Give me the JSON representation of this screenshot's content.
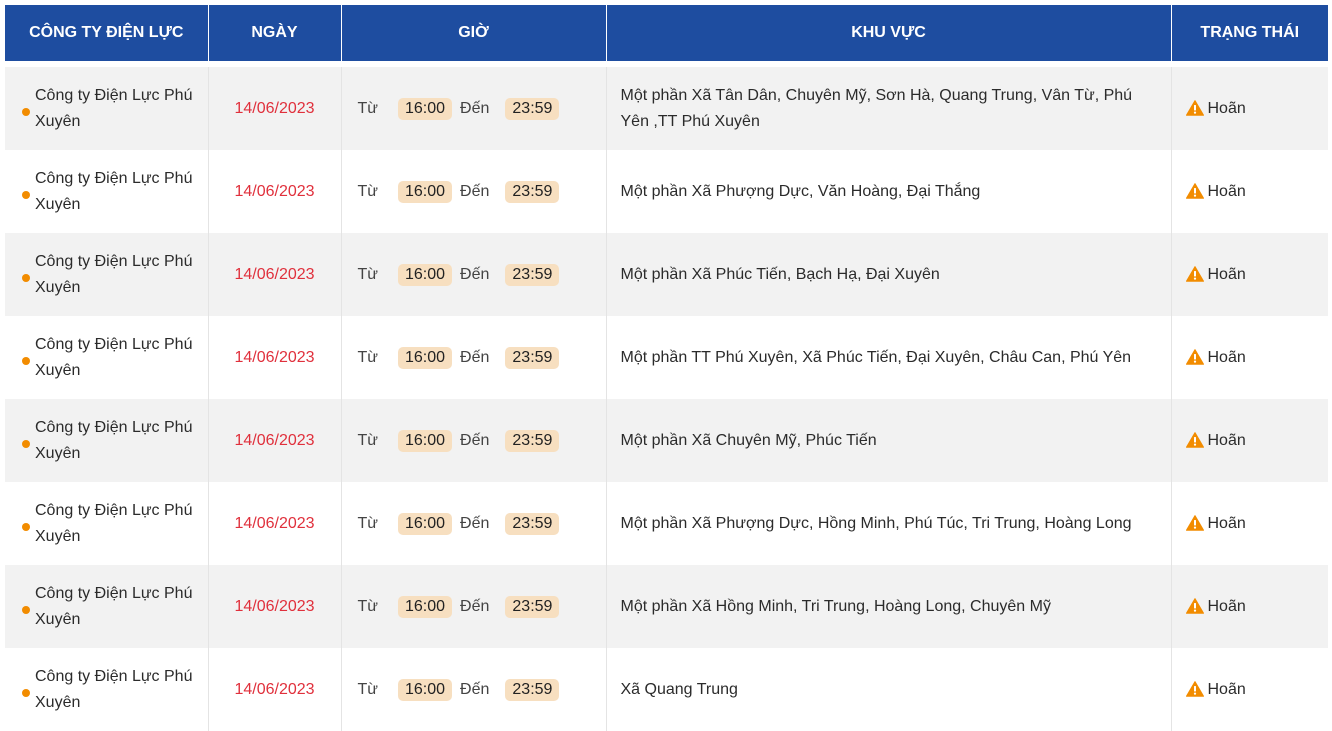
{
  "header": {
    "company": "CÔNG TY ĐIỆN LỰC",
    "date": "NGÀY",
    "time": "GIỜ",
    "area": "KHU VỰC",
    "status": "TRẠNG THÁI"
  },
  "labels": {
    "from": "Từ",
    "to": "Đến"
  },
  "rows": [
    {
      "company": "Công ty Điện Lực Phú Xuyên",
      "date": "14/06/2023",
      "start": "16:00",
      "end": "23:59",
      "area": "Một phần Xã Tân Dân, Chuyên Mỹ, Sơn Hà, Quang Trung, Vân Từ, Phú Yên ,TT Phú Xuyên",
      "status": "Hoãn"
    },
    {
      "company": "Công ty Điện Lực Phú Xuyên",
      "date": "14/06/2023",
      "start": "16:00",
      "end": "23:59",
      "area": "Một phần Xã Phượng Dực, Văn Hoàng, Đại Thắng",
      "status": "Hoãn"
    },
    {
      "company": "Công ty Điện Lực Phú Xuyên",
      "date": "14/06/2023",
      "start": "16:00",
      "end": "23:59",
      "area": "Một phần Xã Phúc Tiến, Bạch Hạ, Đại Xuyên",
      "status": "Hoãn"
    },
    {
      "company": "Công ty Điện Lực Phú Xuyên",
      "date": "14/06/2023",
      "start": "16:00",
      "end": "23:59",
      "area": "Một phần TT Phú Xuyên, Xã Phúc Tiến, Đại Xuyên, Châu Can, Phú Yên",
      "status": "Hoãn"
    },
    {
      "company": "Công ty Điện Lực Phú Xuyên",
      "date": "14/06/2023",
      "start": "16:00",
      "end": "23:59",
      "area": "Một phần Xã Chuyên Mỹ, Phúc Tiến",
      "status": "Hoãn"
    },
    {
      "company": "Công ty Điện Lực Phú Xuyên",
      "date": "14/06/2023",
      "start": "16:00",
      "end": "23:59",
      "area": "Một phần Xã Phượng Dực, Hồng Minh, Phú Túc, Tri Trung, Hoàng Long",
      "status": "Hoãn"
    },
    {
      "company": "Công ty Điện Lực Phú Xuyên",
      "date": "14/06/2023",
      "start": "16:00",
      "end": "23:59",
      "area": "Một phần Xã Hồng Minh, Tri Trung, Hoàng Long, Chuyên Mỹ",
      "status": "Hoãn"
    },
    {
      "company": "Công ty Điện Lực Phú Xuyên",
      "date": "14/06/2023",
      "start": "16:00",
      "end": "23:59",
      "area": "Xã Quang Trung",
      "status": "Hoãn"
    }
  ],
  "colors": {
    "header_bg": "#1e4da0",
    "date_text": "#e0303c",
    "dot": "#f28c00",
    "pill_bg": "#f7dfc0",
    "warning": "#f28c00"
  },
  "icons": {
    "status": "warning-icon",
    "bullet": "dot-icon"
  }
}
